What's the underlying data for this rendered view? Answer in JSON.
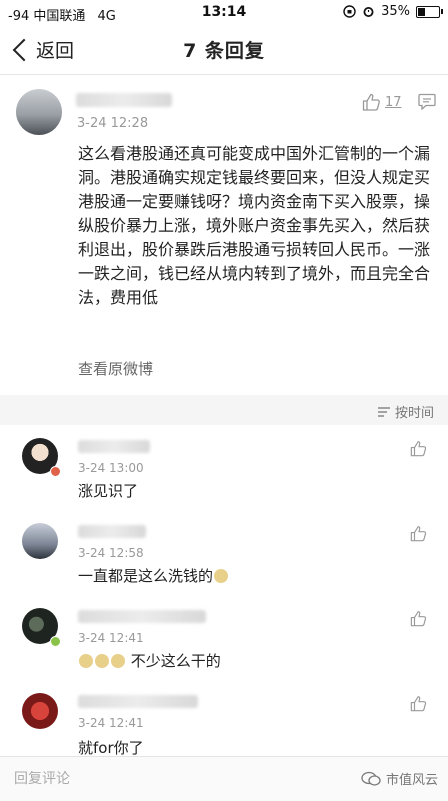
{
  "status": {
    "signal": "-94",
    "carrier": "中国联通",
    "network": "4G",
    "time": "13:14",
    "battery": "35%",
    "battery_level": 0.35
  },
  "nav": {
    "back_label": "返回",
    "title": "7 条回复"
  },
  "post": {
    "time": "3-24 12:28",
    "like_count": "17",
    "text": "这么看港股通还真可能变成中国外汇管制的一个漏洞。港股通确实规定钱最终要回来，但没人规定买港股通一定要赚钱呀？境内资金南下买入股票，操纵股价暴力上涨，境外账户资金事先买入，然后获利退出，股价暴跌后港股通亏损转回人民币。一涨一跌之间，钱已经从境内转到了境外，而且完全合法，费用低",
    "view_original": "查看原微博"
  },
  "sort": {
    "label": "按时间"
  },
  "comments": [
    {
      "time": "3-24 13:00",
      "text": "涨见识了"
    },
    {
      "time": "3-24 12:58",
      "text": "一直都是这么洗钱的"
    },
    {
      "time": "3-24 12:41",
      "text": "不少这么干的"
    },
    {
      "time": "3-24 12:41",
      "text": "就for你了"
    }
  ],
  "input": {
    "placeholder": "回复评论"
  },
  "watermark": {
    "text": "市值风云"
  },
  "colors": {
    "text": "#222222",
    "meta": "#999999",
    "band": "#f5f5f5"
  }
}
